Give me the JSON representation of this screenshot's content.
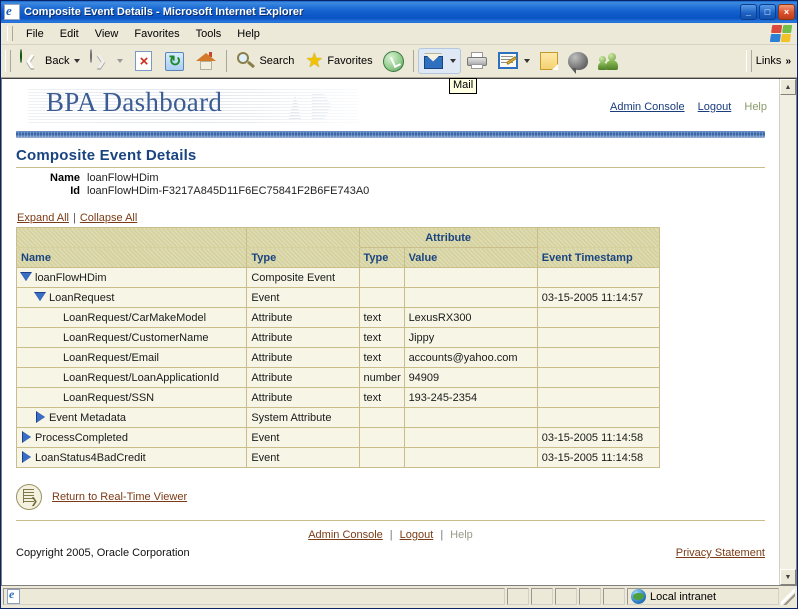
{
  "window": {
    "title": "Composite Event Details - Microsoft Internet Explorer",
    "minimize_label": "_",
    "maximize_label": "□",
    "close_label": "×"
  },
  "menu": {
    "items": [
      "File",
      "Edit",
      "View",
      "Favorites",
      "Tools",
      "Help"
    ]
  },
  "toolbar": {
    "back_label": "Back",
    "search_label": "Search",
    "favorites_label": "Favorites",
    "links_label": "Links",
    "chevrons": "»",
    "tooltip": "Mail",
    "buttons": [
      "back-button",
      "forward-button",
      "stop-button",
      "refresh-button",
      "home-button",
      "search-button",
      "favorites-button",
      "history-button",
      "mail-button",
      "print-button",
      "edit-button",
      "notes-button",
      "messenger-button",
      "people-button"
    ]
  },
  "header": {
    "brand": "BPA Dashboard",
    "links": [
      {
        "label": "Admin Console",
        "enabled": true
      },
      {
        "label": "Logout",
        "enabled": true
      },
      {
        "label": "Help",
        "enabled": false
      }
    ]
  },
  "page": {
    "title": "Composite Event Details",
    "fields": [
      {
        "key": "Name",
        "value": "loanFlowHDim"
      },
      {
        "key": "Id",
        "value": "loanFlowHDim-F3217A845D11F6EC75841F2B6FE743A0"
      }
    ],
    "expand_all": "Expand All",
    "collapse_all": "Collapse All",
    "link_separator": "|"
  },
  "table": {
    "group_header": "Attribute",
    "headers": {
      "name": "Name",
      "type": "Type",
      "attr_type": "Type",
      "attr_value": "Value",
      "timestamp": "Event Timestamp"
    },
    "rows": [
      {
        "name": "loanFlowHDim",
        "indent": 0,
        "toggle": "expanded",
        "type": "Composite Event",
        "attr_type": "",
        "attr_value": "",
        "timestamp": ""
      },
      {
        "name": "LoanRequest",
        "indent": 1,
        "toggle": "expanded",
        "type": "Event",
        "attr_type": "",
        "attr_value": "",
        "timestamp": "03-15-2005 11:14:57"
      },
      {
        "name": "LoanRequest/CarMakeModel",
        "indent": 2,
        "toggle": "none",
        "type": "Attribute",
        "attr_type": "text",
        "attr_value": "LexusRX300",
        "timestamp": ""
      },
      {
        "name": "LoanRequest/CustomerName",
        "indent": 2,
        "toggle": "none",
        "type": "Attribute",
        "attr_type": "text",
        "attr_value": "Jippy",
        "timestamp": ""
      },
      {
        "name": "LoanRequest/Email",
        "indent": 2,
        "toggle": "none",
        "type": "Attribute",
        "attr_type": "text",
        "attr_value": "accounts@yahoo.com",
        "timestamp": ""
      },
      {
        "name": "LoanRequest/LoanApplicationId",
        "indent": 2,
        "toggle": "none",
        "type": "Attribute",
        "attr_type": "number",
        "attr_value": "94909",
        "timestamp": ""
      },
      {
        "name": "LoanRequest/SSN",
        "indent": 2,
        "toggle": "none",
        "type": "Attribute",
        "attr_type": "text",
        "attr_value": "193-245-2354",
        "timestamp": ""
      },
      {
        "name": "Event Metadata",
        "indent": 1,
        "toggle": "collapsed",
        "type": "System Attribute",
        "attr_type": "",
        "attr_value": "",
        "timestamp": ""
      },
      {
        "name": "ProcessCompleted",
        "indent": 0,
        "toggle": "collapsed",
        "type": "Event",
        "attr_type": "",
        "attr_value": "",
        "timestamp": "03-15-2005 11:14:58"
      },
      {
        "name": "LoanStatus4BadCredit",
        "indent": 0,
        "toggle": "collapsed",
        "type": "Event",
        "attr_type": "",
        "attr_value": "",
        "timestamp": "03-15-2005 11:14:58"
      }
    ]
  },
  "return_link": "Return to Real-Time Viewer",
  "footer": {
    "links": [
      {
        "label": "Admin Console",
        "enabled": true
      },
      {
        "label": "Logout",
        "enabled": true
      },
      {
        "label": "Help",
        "enabled": false
      }
    ],
    "separator": "|",
    "copyright": "Copyright 2005, Oracle Corporation",
    "privacy": "Privacy Statement"
  },
  "statusbar": {
    "message": "",
    "zone": "Local intranet"
  },
  "colors": {
    "title_blue": "#1a4480",
    "brand_blue": "#3b5c93",
    "link_brown": "#7b3b16",
    "header_tan": "#d6d2a0",
    "row_cream": "#f7f5e6",
    "grid_border": "#c9bd8a",
    "triangle_blue": "#3a6ec4"
  }
}
